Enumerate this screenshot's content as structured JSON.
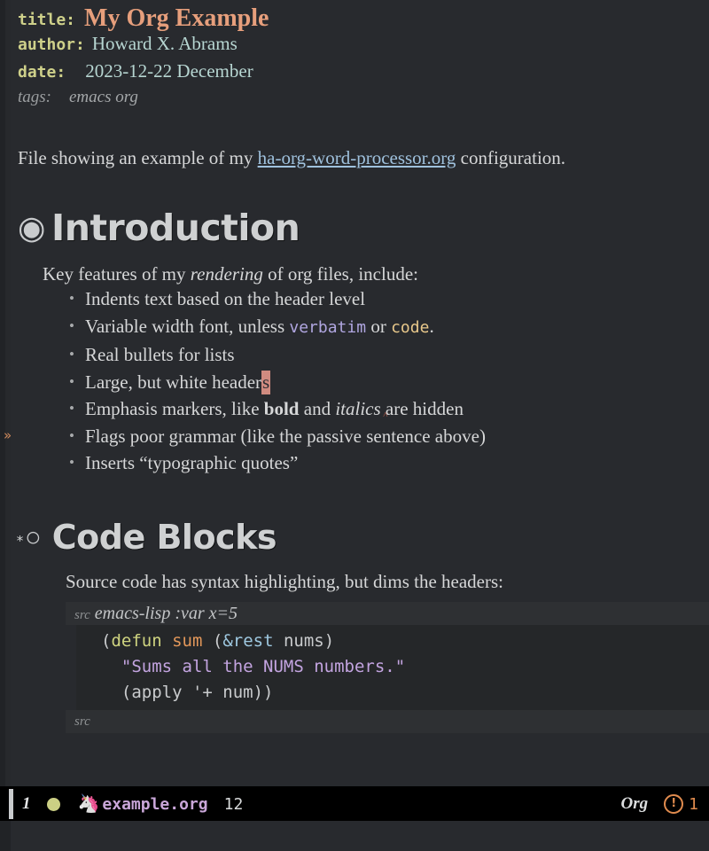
{
  "document": {
    "keywords": [
      {
        "key": "title:",
        "value": "My Org Example",
        "style": "title"
      },
      {
        "key": "author:",
        "value": "Howard X. Abrams",
        "style": "meta"
      },
      {
        "key": "date:",
        "value": "2023-12-22 December",
        "style": "meta"
      },
      {
        "key": "tags:",
        "value": "emacs org",
        "style": "tags"
      }
    ],
    "intro": {
      "before": "File showing an example of my ",
      "link": "ha-org-word-processor.org",
      "after": " configuration."
    }
  },
  "sections": [
    {
      "bullet": "◉",
      "stars": "",
      "heading": "Introduction",
      "lead_before": "Key features of my ",
      "lead_italic": "rendering",
      "lead_after": " of org files, include:",
      "items": [
        {
          "bullet": "•",
          "text": "Indents text based on the header level"
        },
        {
          "bullet": "•",
          "text": "Variable width font, unless verbatim or code.",
          "parts": [
            {
              "t": "Variable width font, unless ",
              "k": "plain"
            },
            {
              "t": "verbatim",
              "k": "verbatim"
            },
            {
              "t": " or ",
              "k": "plain"
            },
            {
              "t": "code",
              "k": "code"
            },
            {
              "t": ".",
              "k": "plain"
            }
          ]
        },
        {
          "bullet": "•",
          "text": "Real bullets for lists"
        },
        {
          "bullet": "•",
          "text": "Large, but white headers",
          "parts": [
            {
              "t": "Large, but white header",
              "k": "plain"
            },
            {
              "t": "s",
              "k": "cursor"
            }
          ]
        },
        {
          "bullet": "•",
          "text": "Emphasis markers, like bold and italics are hidden",
          "parts": [
            {
              "t": "Emphasis markers, like ",
              "k": "plain"
            },
            {
              "t": "bold",
              "k": "bold"
            },
            {
              "t": " and ",
              "k": "plain"
            },
            {
              "t": "italics",
              "k": "italic"
            },
            {
              "t": " ",
              "k": "grammar"
            },
            {
              "t": "are hidden",
              "k": "plain"
            }
          ]
        },
        {
          "bullet": "•",
          "text": "Flags poor grammar (like the passive sentence above)"
        },
        {
          "bullet": "•",
          "text": "Inserts “typographic quotes”"
        }
      ]
    },
    {
      "bullet": "○",
      "stars": "*",
      "heading": "Code Blocks",
      "lead": "Source code has syntax highlighting, but dims the headers:",
      "src_block": {
        "begin_keyword": "src",
        "begin_args": "emacs-lisp :var x=5",
        "end_keyword": "src",
        "lines": [
          [
            {
              "t": "(",
              "k": "plain"
            },
            {
              "t": "defun",
              "k": "keyword"
            },
            {
              "t": " ",
              "k": "plain"
            },
            {
              "t": "sum",
              "k": "function"
            },
            {
              "t": " (",
              "k": "plain"
            },
            {
              "t": "&rest",
              "k": "arg"
            },
            {
              "t": " nums)",
              "k": "plain"
            }
          ],
          [
            {
              "t": "  ",
              "k": "plain"
            },
            {
              "t": "\"Sums all the NUMS numbers.\"",
              "k": "string"
            }
          ],
          [
            {
              "t": "  (apply '+ num))",
              "k": "plain"
            }
          ]
        ]
      }
    }
  ],
  "modeline": {
    "window_number": "1",
    "status_dot": "status-dot",
    "gnu_icon": "gnu-icon",
    "buffer_name": "example.org",
    "position": "12",
    "major_mode": "Org",
    "warning_icon": "!",
    "warning_count": "1"
  },
  "colors": {
    "background": "#282a2e",
    "keyword": "#ced08a",
    "title": "#e79f7c",
    "meta": "#b7d6d2",
    "link": "#9fc1dd",
    "heading": "#cfd1d2",
    "cursor": "#d08b80",
    "verbatim": "#b0a6e0",
    "code": "#e8c88b",
    "modeline_bg": "#000000",
    "buffer_name": "#c9a6d8",
    "warning": "#e08b4e"
  }
}
